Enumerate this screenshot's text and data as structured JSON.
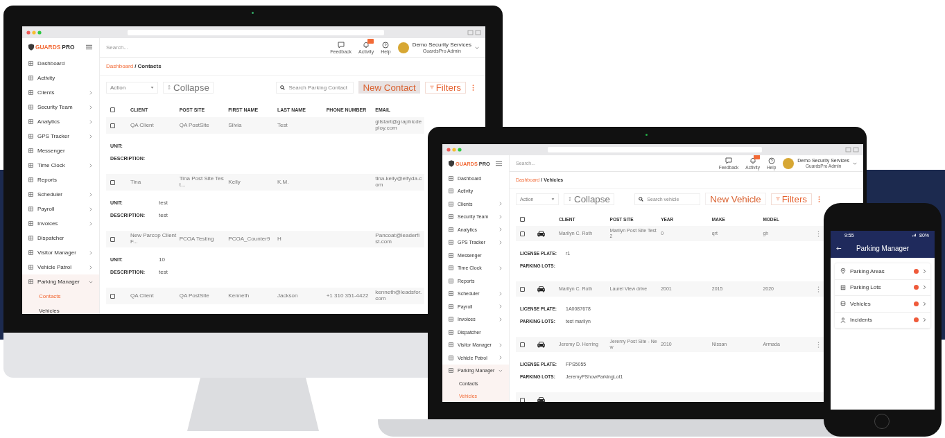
{
  "monitor": {
    "app": {
      "logo": {
        "accent": "GUARDS",
        "rest": "PRO"
      },
      "search_placeholder": "Search...",
      "header_buttons": [
        {
          "label": "Feedback",
          "has_badge": false
        },
        {
          "label": "Activity",
          "has_badge": true
        },
        {
          "label": "Help",
          "has_badge": false
        }
      ],
      "user": {
        "name": "Demo Security Services",
        "role": "GuardsPro Admin"
      },
      "sidebar": [
        {
          "label": "Dashboard",
          "kind": "link"
        },
        {
          "label": "Activity",
          "kind": "link"
        },
        {
          "label": "Clients",
          "kind": "group",
          "expanded": false
        },
        {
          "label": "Security Team",
          "kind": "group",
          "expanded": false
        },
        {
          "label": "Analytics",
          "kind": "group",
          "expanded": false
        },
        {
          "label": "GPS Tracker",
          "kind": "group",
          "expanded": false
        },
        {
          "label": "Messenger",
          "kind": "link"
        },
        {
          "label": "Time Clock",
          "kind": "group",
          "expanded": false
        },
        {
          "label": "Reports",
          "kind": "link"
        },
        {
          "label": "Scheduler",
          "kind": "group",
          "expanded": false
        },
        {
          "label": "Payroll",
          "kind": "group",
          "expanded": false
        },
        {
          "label": "Invoices",
          "kind": "group",
          "expanded": false
        },
        {
          "label": "Dispatcher",
          "kind": "link"
        },
        {
          "label": "Visitor Manager",
          "kind": "group",
          "expanded": false
        },
        {
          "label": "Vehicle Patrol",
          "kind": "group",
          "expanded": false
        },
        {
          "label": "Parking Manager",
          "kind": "group",
          "expanded": true,
          "children": [
            {
              "label": "Contacts",
              "selected": true
            },
            {
              "label": "Vehicles",
              "selected": false
            }
          ]
        }
      ],
      "breadcrumb": {
        "items": [
          "Dashboard",
          "Contacts"
        ],
        "separator": "/"
      },
      "toolbar": {
        "action": "Action",
        "collapse": "Collapse",
        "search_placeholder": "Search Parking Contact",
        "primary": "New Contact",
        "filter": "Filters"
      },
      "table": {
        "header_checked": false,
        "columns": [
          "CLIENT",
          "POST SITE",
          "FIRST NAME",
          "LAST NAME",
          "PHONE NUMBER",
          "EMAIL"
        ],
        "rows": [
          {
            "checked": false,
            "vehicle_icon": false,
            "has_menu": false,
            "cells": [
              "QA Client",
              "QA PostSite",
              "Silvia",
              "Test",
              null,
              "gilstart@graphicdeploy.com"
            ],
            "details": [
              {
                "label": "UNIT:"
              },
              {
                "label": "DESCRIPTION:"
              }
            ]
          },
          {
            "checked": false,
            "vehicle_icon": false,
            "has_menu": false,
            "cells": [
              "Tina",
              "Tina Post Site Test...",
              "Kelly",
              "K.M.",
              null,
              "tina.kelly@eltyda.com"
            ],
            "details": [
              {
                "label": "UNIT:",
                "value": "test"
              },
              {
                "label": "DESCRIPTION:",
                "value": "test"
              }
            ]
          },
          {
            "checked": false,
            "vehicle_icon": false,
            "has_menu": false,
            "cells": [
              "New Parcop Client F...",
              "PCOA Testing",
              "PCOA_Counter9",
              "H",
              null,
              "Pancoat@leaderfist.com"
            ],
            "details": [
              {
                "label": "UNIT:",
                "value": "10"
              },
              {
                "label": "DESCRIPTION:",
                "value": "test"
              }
            ]
          },
          {
            "checked": false,
            "vehicle_icon": false,
            "has_menu": false,
            "cells": [
              "QA Client",
              "QA PostSite",
              "Kenneth",
              "Jackson",
              "+1 310 351-4422",
              "kenneth@leadsfor.com"
            ]
          }
        ]
      }
    }
  },
  "laptop": {
    "app": {
      "logo": {
        "accent": "GUARDS",
        "rest": "PRO"
      },
      "search_placeholder": "Search...",
      "header_buttons": [
        {
          "label": "Feedback",
          "has_badge": false
        },
        {
          "label": "Activity",
          "has_badge": true
        },
        {
          "label": "Help",
          "has_badge": false
        }
      ],
      "user": {
        "name": "Demo Security Services",
        "role": "GuardsPro Admin"
      },
      "sidebar": [
        {
          "label": "Dashboard",
          "kind": "link"
        },
        {
          "label": "Activity",
          "kind": "link"
        },
        {
          "label": "Clients",
          "kind": "group",
          "expanded": false
        },
        {
          "label": "Security Team",
          "kind": "group",
          "expanded": false
        },
        {
          "label": "Analytics",
          "kind": "group",
          "expanded": false
        },
        {
          "label": "GPS Tracker",
          "kind": "group",
          "expanded": false
        },
        {
          "label": "Messenger",
          "kind": "link"
        },
        {
          "label": "Time Clock",
          "kind": "group",
          "expanded": false
        },
        {
          "label": "Reports",
          "kind": "link"
        },
        {
          "label": "Scheduler",
          "kind": "group",
          "expanded": false
        },
        {
          "label": "Payroll",
          "kind": "group",
          "expanded": false
        },
        {
          "label": "Invoices",
          "kind": "group",
          "expanded": false
        },
        {
          "label": "Dispatcher",
          "kind": "link"
        },
        {
          "label": "Visitor Manager",
          "kind": "group",
          "expanded": false
        },
        {
          "label": "Vehicle Patrol",
          "kind": "group",
          "expanded": false
        },
        {
          "label": "Parking Manager",
          "kind": "group",
          "expanded": true,
          "children": [
            {
              "label": "Contacts",
              "selected": false
            },
            {
              "label": "Vehicles",
              "selected": true
            }
          ]
        }
      ],
      "breadcrumb": {
        "items": [
          "Dashboard",
          "Vehicles"
        ],
        "separator": "/"
      },
      "toolbar": {
        "action": "Action",
        "collapse": "Collapse",
        "search_placeholder": "Search vehicle",
        "primary": "New Vehicle",
        "filter": "Filters"
      },
      "table": {
        "header_checked": false,
        "columns": [
          "CLIENT",
          "POST SITE",
          "YEAR",
          "MAKE",
          "MODEL"
        ],
        "rows": [
          {
            "checked": false,
            "vehicle_icon": true,
            "has_menu": true,
            "cells": [
              "Marilyn C. Roth",
              "Marilyn Post Site Test 2",
              "0",
              "qrt",
              "gh"
            ],
            "details": [
              {
                "label": "LICENSE PLATE:",
                "value": "r1"
              },
              {
                "label": "PARKING LOTS:"
              }
            ]
          },
          {
            "checked": false,
            "vehicle_icon": true,
            "has_menu": true,
            "cells": [
              "Marilyn C. Roth",
              "Laurel View drive",
              "2001",
              "2015",
              "2020"
            ],
            "details": [
              {
                "label": "LICENSE PLATE:",
                "value": "1A0087678"
              },
              {
                "label": "PARKING LOTS:",
                "value": "test marilyn"
              }
            ]
          },
          {
            "checked": false,
            "vehicle_icon": true,
            "has_menu": true,
            "cells": [
              "Jeremy D. Herring",
              "Jeremy Post Site - New",
              "2010",
              "Nissan",
              "Armada"
            ],
            "details": [
              {
                "label": "LICENSE PLATE:",
                "value": "FPS5055"
              },
              {
                "label": "PARKING LOTS:",
                "value": "JeremyPShowParkingLot1"
              }
            ]
          },
          {
            "checked": false,
            "vehicle_icon": true,
            "has_menu": false
          }
        ]
      }
    }
  },
  "phone": {
    "status_time": "9:55",
    "status_battery": "80%",
    "title": "Parking Manager",
    "items": [
      {
        "label": "Parking Areas",
        "has_badge": true
      },
      {
        "label": "Parking Lots",
        "has_badge": true
      },
      {
        "label": "Vehicles",
        "has_badge": true
      },
      {
        "label": "Incidents",
        "has_badge": true
      }
    ]
  }
}
